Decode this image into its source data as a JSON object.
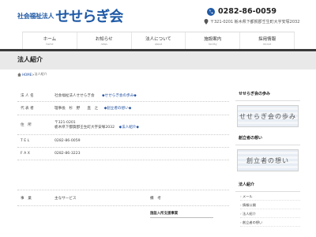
{
  "header": {
    "logo_sub": "社会福祉法人",
    "logo_main": "せせらぎ会",
    "tel": "0282-86-0059",
    "address": "〒321-0201 栃木県下都賀郡壬生町大字安塚2032"
  },
  "nav": {
    "items": [
      {
        "jp": "ホーム",
        "en": "home"
      },
      {
        "jp": "お知らせ",
        "en": "news"
      },
      {
        "jp": "法人について",
        "en": "about"
      },
      {
        "jp": "施設案内",
        "en": "facility"
      },
      {
        "jp": "採用情報",
        "en": "recruit"
      }
    ]
  },
  "page": {
    "title": "法人紹介",
    "breadcrumb_home": "HOME",
    "breadcrumb_sep": " > ",
    "breadcrumb_current": "法人紹介"
  },
  "profile": {
    "rows": [
      {
        "label": "法 人 名",
        "value": "社会福祉法人せせらぎ会",
        "link": "◆せせらぎ会の歩み◆"
      },
      {
        "label": "代 表 者",
        "value": "理事長　杉　野　　直　之",
        "link": "◆創立者の想い◆"
      },
      {
        "label": "住　所",
        "value": "〒321-0201",
        "value2": "栃木県下都賀郡壬生町大字安塚2032",
        "link": "◆法人紹介◆"
      },
      {
        "label": "T E L",
        "value": "0282-86-0059"
      },
      {
        "label": "F A X",
        "value": "0282-86-3223"
      }
    ],
    "services_label": "事　業",
    "services_value": "主なサービス",
    "notes_label": "備　考",
    "facility_name": "施設入所支援事業"
  },
  "sidebar": {
    "section1_title": "せせらぎ会の歩み",
    "banner1": "せせらぎ会の歩み",
    "section2_title": "創立者の想い",
    "banner2": "創立者の想い",
    "section3_title": "法人紹介",
    "list": [
      "メール",
      "情報公開",
      "法人紹介",
      "創立者の想い"
    ]
  },
  "colors": {
    "brand": "#1f5aa6",
    "nav_bar": "#3a3a3a"
  }
}
